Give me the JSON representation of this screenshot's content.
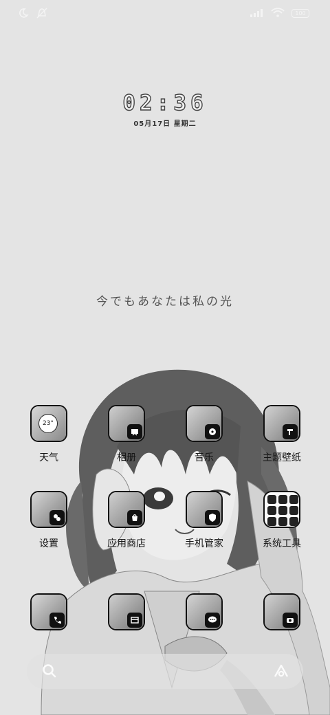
{
  "status_bar": {
    "battery": "100",
    "left_icons": [
      "moon-icon",
      "alarm-off-icon"
    ],
    "right_icons": [
      "signal-icon",
      "wifi-icon",
      "battery-icon"
    ]
  },
  "lockscreen": {
    "time": "02:36",
    "date": "05月17日  星期二",
    "quote": "今でもあなたは私の光"
  },
  "apps": [
    {
      "label": "天气",
      "icon": "weather-icon",
      "weather_temp": "23°"
    },
    {
      "label": "相册",
      "icon": "gallery-icon"
    },
    {
      "label": "音乐",
      "icon": "music-icon"
    },
    {
      "label": "主题壁纸",
      "icon": "theme-icon"
    },
    {
      "label": "设置",
      "icon": "settings-icon"
    },
    {
      "label": "应用商店",
      "icon": "app-store-icon"
    },
    {
      "label": "手机管家",
      "icon": "phone-manager-icon"
    },
    {
      "label": "系统工具",
      "icon": "system-tools-folder-icon"
    }
  ],
  "dock": [
    {
      "icon": "phone-icon"
    },
    {
      "icon": "browser-icon"
    },
    {
      "icon": "messages-icon"
    },
    {
      "icon": "camera-icon"
    }
  ],
  "search": {
    "icon": "search-icon",
    "assistant_icon": "assistant-icon"
  }
}
